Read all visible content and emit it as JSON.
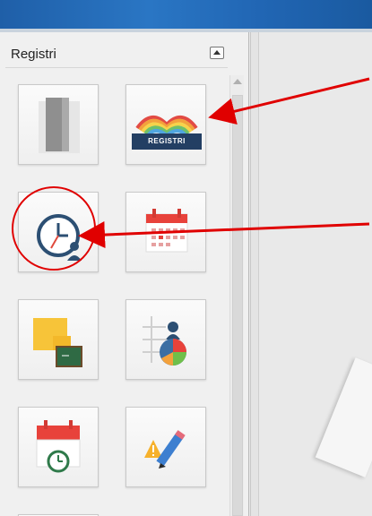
{
  "panel": {
    "title": "Registri",
    "tiles": [
      {
        "name": "agenda-tile",
        "icon": "notebook-icon"
      },
      {
        "name": "registri-tile",
        "icon": "rainbow-book-icon",
        "label": "REGISTRI"
      },
      {
        "name": "orario-tile",
        "icon": "clock-user-icon"
      },
      {
        "name": "calendario-tile",
        "icon": "calendar-icon"
      },
      {
        "name": "note-tile",
        "icon": "sticky-note-icon"
      },
      {
        "name": "statistiche-tile",
        "icon": "chart-user-icon"
      },
      {
        "name": "eventi-tile",
        "icon": "calendar-clock-icon"
      },
      {
        "name": "modifica-tile",
        "icon": "warning-pencil-icon"
      }
    ]
  },
  "colors": {
    "accent_blue": "#2a76c4",
    "label_navy": "#233f63",
    "annotation_red": "#e00000"
  }
}
